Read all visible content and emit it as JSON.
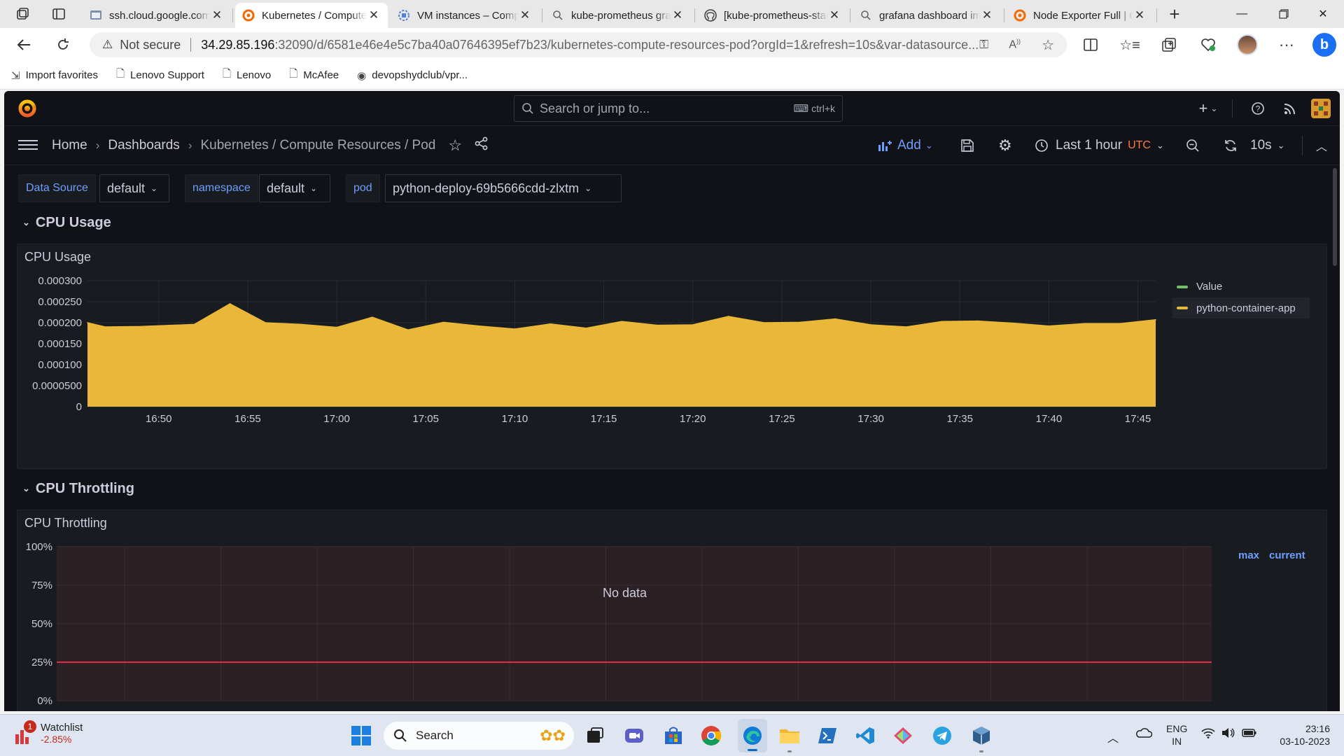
{
  "browser": {
    "tabs": [
      {
        "label": "ssh.cloud.google.com",
        "icon": "terminal-page-icon"
      },
      {
        "label": "Kubernetes / Compute Resources / Pod",
        "icon": "grafana-icon",
        "active": true
      },
      {
        "label": "VM instances – Compute Engine",
        "icon": "compute-engine-icon"
      },
      {
        "label": "kube-prometheus grafana",
        "icon": "search-icon"
      },
      {
        "label": "[kube-prometheus-stack]",
        "icon": "github-icon"
      },
      {
        "label": "grafana dashboard import",
        "icon": "search-icon"
      },
      {
        "label": "Node Exporter Full | Grafana Labs",
        "icon": "grafana-icon"
      }
    ],
    "not_secure": "Not secure",
    "url_host": "34.29.85.196",
    "url_path": ":32090/d/6581e46e4e5c7ba40a07646395ef7b23/kubernetes-compute-resources-pod?orgId=1&refresh=10s&var-datasource...",
    "favorites": [
      {
        "label": "Import favorites",
        "icon": "import-icon"
      },
      {
        "label": "Lenovo Support",
        "icon": "page-icon"
      },
      {
        "label": "Lenovo",
        "icon": "page-icon"
      },
      {
        "label": "McAfee",
        "icon": "page-icon"
      },
      {
        "label": "devopshydclub/vpr...",
        "icon": "github-icon"
      }
    ]
  },
  "grafana": {
    "search_placeholder": "Search or jump to...",
    "search_shortcut": "ctrl+k",
    "breadcrumb": [
      "Home",
      "Dashboards",
      "Kubernetes / Compute Resources / Pod"
    ],
    "add_label": "Add",
    "time_range": "Last 1 hour",
    "timezone": "UTC",
    "refresh_interval": "10s",
    "variables": [
      {
        "label": "Data Source",
        "value": "default"
      },
      {
        "label": "namespace",
        "value": "default"
      },
      {
        "label": "pod",
        "value": "python-deploy-69b5666cdd-zlxtm"
      }
    ],
    "rows": [
      "CPU Usage",
      "CPU Throttling"
    ],
    "panels": {
      "cpu_usage": {
        "title": "CPU Usage",
        "legend": [
          "Value",
          "python-container-app"
        ]
      },
      "cpu_throttling": {
        "title": "CPU Throttling",
        "no_data": "No data",
        "legend_headers": [
          "max",
          "current"
        ]
      }
    },
    "colors": {
      "accent": "#6e9fff",
      "series_fill": "#eab839",
      "threshold": "#e02f44",
      "value_series": "#73bf69"
    }
  },
  "chart_data": [
    {
      "type": "area",
      "title": "CPU Usage",
      "xlabel": "",
      "ylabel": "",
      "ylim": [
        0,
        0.0003
      ],
      "y_ticks": [
        "0",
        "0.0000500",
        "0.000100",
        "0.000150",
        "0.000200",
        "0.000250",
        "0.000300"
      ],
      "x_ticks": [
        "16:50",
        "16:55",
        "17:00",
        "17:05",
        "17:10",
        "17:15",
        "17:20",
        "17:25",
        "17:30",
        "17:35",
        "17:40",
        "17:45"
      ],
      "legend_position": "right",
      "series": [
        {
          "name": "Value",
          "color": "#73bf69",
          "values": []
        },
        {
          "name": "python-container-app",
          "color": "#eab839",
          "x": [
            "16:46",
            "16:47",
            "16:49",
            "16:52",
            "16:54",
            "16:56",
            "16:58",
            "17:00",
            "17:02",
            "17:04",
            "17:06",
            "17:08",
            "17:10",
            "17:12",
            "17:14",
            "17:16",
            "17:18",
            "17:20",
            "17:22",
            "17:24",
            "17:26",
            "17:28",
            "17:30",
            "17:32",
            "17:34",
            "17:36",
            "17:38",
            "17:40",
            "17:42",
            "17:44",
            "17:46"
          ],
          "values": [
            0.0002,
            0.00019,
            0.000191,
            0.000196,
            0.000245,
            0.0002,
            0.000196,
            0.000189,
            0.000213,
            0.000183,
            0.000201,
            0.000192,
            0.000185,
            0.000197,
            0.000187,
            0.000203,
            0.000194,
            0.000195,
            0.000215,
            0.0002,
            0.000201,
            0.000209,
            0.000195,
            0.00019,
            0.000203,
            0.000204,
            0.000199,
            0.000192,
            0.000198,
            0.000198,
            0.000207
          ]
        }
      ]
    },
    {
      "type": "line",
      "title": "CPU Throttling",
      "ylim": [
        0,
        1
      ],
      "y_ticks": [
        "0%",
        "25%",
        "50%",
        "75%",
        "100%"
      ],
      "threshold": 0.25,
      "series": []
    }
  ],
  "taskbar": {
    "watchlist_label": "Watchlist",
    "watchlist_change": "-2.85%",
    "watchlist_badge": "1",
    "search_label": "Search",
    "lang": "ENG",
    "region": "IN",
    "time": "23:16",
    "date": "03-10-2023"
  }
}
